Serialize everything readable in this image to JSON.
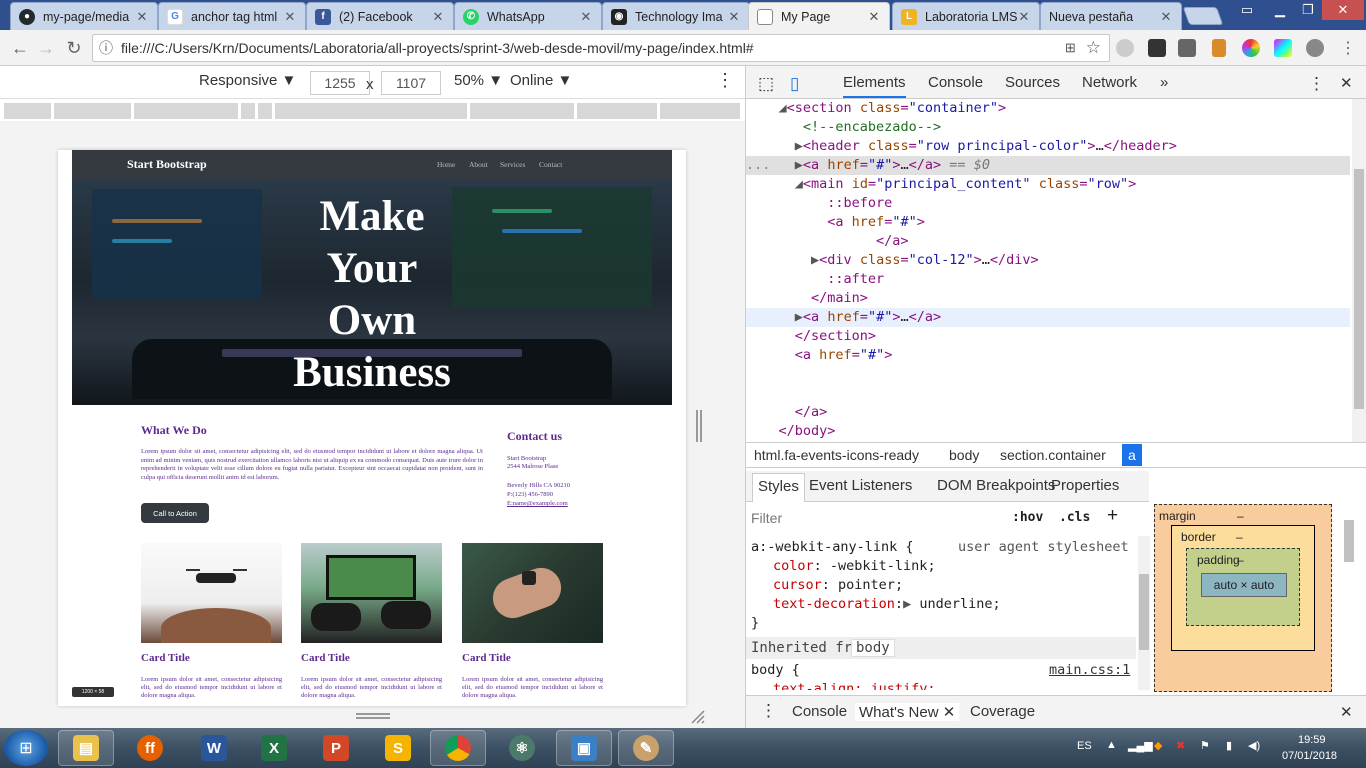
{
  "browser": {
    "tabs": [
      {
        "title": "my-page/media",
        "icon": "github-icon",
        "color": "#24292e"
      },
      {
        "title": "anchor tag html",
        "icon": "google-icon",
        "color": "#ffffff"
      },
      {
        "title": "(2) Facebook",
        "icon": "facebook-icon",
        "color": "#3b5998"
      },
      {
        "title": "WhatsApp",
        "icon": "whatsapp-icon",
        "color": "#25d366"
      },
      {
        "title": "Technology Ima",
        "icon": "camera-icon",
        "color": "#222222"
      },
      {
        "title": "My Page",
        "icon": "document-icon",
        "color": "#ffffff",
        "active": true
      },
      {
        "title": "Laboratoria LMS",
        "icon": "laboratoria-icon",
        "color": "#f0b323"
      },
      {
        "title": "Nueva pestaña",
        "icon": "none",
        "color": "#ffffff"
      }
    ],
    "url": "file:///C:/Users/Krn/Documents/Laboratoria/all-proyects/sprint-3/web-desde-movil/my-page/index.html#"
  },
  "device_toolbar": {
    "mode": "Responsive",
    "width": "1255",
    "height": "1107",
    "times": "x",
    "zoom": "50%",
    "throttle": "Online"
  },
  "site": {
    "brand": "Start Bootstrap",
    "nav": [
      "Home",
      "About",
      "Services",
      "Contact"
    ],
    "hero_title_lines": [
      "Make",
      "Your",
      "Own",
      "Business"
    ],
    "what_title": "What We Do",
    "what_text": "Lorem ipsum dolor sit amet, consectetur adipisicing elit, sed do eiusmod tempor incididunt ut labore et dolore magna aliqua. Ut enim ad minim veniam, quis nostrud exercitation ullamco laboris nisi ut aliquip ex ea commodo consequat. Duis aute irure dolor in reprehenderit in voluptate velit esse cillum dolore eu fugiat nulla pariatur. Excepteur sint occaecat cupidatat non proident, sunt in culpa qui officia deserunt mollit anim id est laborum.",
    "cta": "Call to Action",
    "contact_title": "Contact us",
    "contact_lines": [
      "Start Bootstrap",
      "2544 Malrose Plase",
      "",
      "Beverly Hills CA 90210",
      "P:(123) 456-7890",
      "E:name@example.com"
    ],
    "cards": [
      {
        "title": "Card Title",
        "text": "Lorem ipsum dolor sit amet, consectetur adipisicing elit, sed do eiusmod tempor incididunt ut labore et dolore magna aliqua."
      },
      {
        "title": "Card Title",
        "text": "Lorem ipsum dolor sit amet, consectetur adipisicing elit, sed do eiusmod tempor incididunt ut labore et dolore magna aliqua."
      },
      {
        "title": "Card Title",
        "text": "Lorem ipsum dolor sit amet, consectetur adipisicing elit, sed do eiusmod tempor incididunt ut labore et dolore magna aliqua."
      }
    ],
    "size_tip": "1200 × 58"
  },
  "devtools": {
    "tabs": [
      "Elements",
      "Console",
      "Sources",
      "Network",
      "»"
    ],
    "dom_lines": [
      {
        "kind": "open",
        "text": "<section class=\"container\">"
      },
      {
        "kind": "comment",
        "text": "<!--encabezado-->"
      },
      {
        "kind": "collapsed",
        "text": "<header class=\"row principal-color\">…</header>"
      },
      {
        "kind": "selected",
        "text": "<a href=\"#\">…</a> == $0"
      },
      {
        "kind": "open",
        "text": "<main id=\"principal_content\" class=\"row\">"
      },
      {
        "kind": "pseudo",
        "text": "::before"
      },
      {
        "kind": "plain",
        "text": "<a href=\"#\">"
      },
      {
        "kind": "plain",
        "text": "</a>"
      },
      {
        "kind": "collapsed",
        "text": "<div class=\"col-12\">…</div>"
      },
      {
        "kind": "pseudo",
        "text": "::after"
      },
      {
        "kind": "plain",
        "text": "</main>"
      },
      {
        "kind": "collapsed",
        "text": "<a href=\"#\">…</a>"
      },
      {
        "kind": "plain",
        "text": "</section>"
      },
      {
        "kind": "plain",
        "text": "<a href=\"#\">"
      },
      {
        "kind": "blank",
        "text": ""
      },
      {
        "kind": "plain",
        "text": "</a>"
      },
      {
        "kind": "plain",
        "text": "</body>"
      }
    ],
    "breadcrumbs": [
      "html.fa-events-icons-ready",
      "body",
      "section.container",
      "a"
    ],
    "style_tabs": [
      "Styles",
      "Event Listeners",
      "DOM Breakpoints",
      "Properties"
    ],
    "filter_placeholder": "Filter",
    "hov": ":hov",
    "cls": ".cls",
    "rule_selector": "a:-webkit-any-link {",
    "rule_source": "user agent stylesheet",
    "rule_props": [
      {
        "name": "color",
        "value": "-webkit-link;"
      },
      {
        "name": "cursor",
        "value": "pointer;"
      },
      {
        "name": "text-decoration",
        "value": "underline;"
      }
    ],
    "inherited_label": "Inherited from",
    "inherited_from": "body",
    "body_rule": "body {",
    "body_source": "main.css:1",
    "body_prop": "text-align: justify;",
    "box_model": {
      "margin": "margin",
      "border": "border",
      "padding": "padding",
      "content": "auto × auto",
      "dash": "–"
    },
    "drawer_tabs": [
      "Console",
      "What's New",
      "Coverage"
    ]
  },
  "taskbar": {
    "apps": [
      "Explorer",
      "Firefox",
      "Word",
      "Excel",
      "PowerPoint",
      "Slides",
      "Chrome",
      "Atom",
      "Photos",
      "Paint"
    ],
    "lang": "ES",
    "time": "19:59",
    "date": "07/01/2018"
  }
}
